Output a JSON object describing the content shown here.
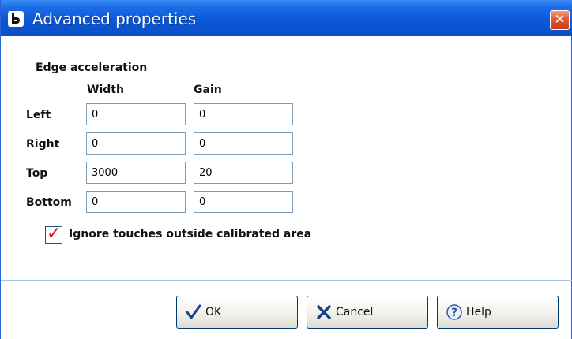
{
  "window": {
    "title": "Advanced properties",
    "close_label": "✕"
  },
  "section": {
    "title": "Edge acceleration",
    "col_width": "Width",
    "col_gain": "Gain"
  },
  "rows": [
    {
      "label": "Left",
      "width": "0",
      "gain": "0"
    },
    {
      "label": "Right",
      "width": "0",
      "gain": "0"
    },
    {
      "label": "Top",
      "width": "3000",
      "gain": "20"
    },
    {
      "label": "Bottom",
      "width": "0",
      "gain": "0"
    }
  ],
  "ignore_outside": {
    "label": "Ignore touches outside calibrated area",
    "checked": true
  },
  "buttons": {
    "ok": "OK",
    "cancel": "Cancel",
    "help": "Help"
  },
  "icons": {
    "app": "app-logo-icon",
    "close": "close-icon",
    "ok": "checkmark-icon",
    "cancel": "x-icon",
    "help": "question-icon"
  },
  "colors": {
    "titlebar": "#0b57d6",
    "close": "#e4572f",
    "check": "#d2111b"
  }
}
